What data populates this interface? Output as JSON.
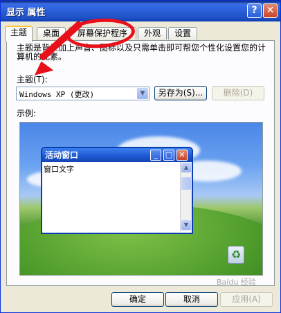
{
  "window": {
    "title": "显示 属性",
    "help_label": "?",
    "close_label": "✕"
  },
  "tabs": [
    {
      "label": "主题",
      "active": true
    },
    {
      "label": "桌面",
      "active": false
    },
    {
      "label": "屏幕保护程序",
      "active": false
    },
    {
      "label": "外观",
      "active": false
    },
    {
      "label": "设置",
      "active": false
    }
  ],
  "theme_page": {
    "description": "主题是背景加上声音、图标以及只需单击即可帮您个性化设置您的计算机的元素。",
    "theme_label": "主题(T):",
    "theme_value": "Windows XP (更改)",
    "save_as_label": "另存为(S)...",
    "delete_label": "删除(D)",
    "preview_label": "示例:"
  },
  "preview": {
    "window_title": "活动窗口",
    "window_text": "窗口文字"
  },
  "footer": {
    "ok_label": "确定",
    "cancel_label": "取消",
    "apply_label": "应用(A)"
  },
  "colors": {
    "highlight": "#E8101A",
    "titlebar": "#2A5ED8"
  },
  "watermark": "Baidu 经验"
}
